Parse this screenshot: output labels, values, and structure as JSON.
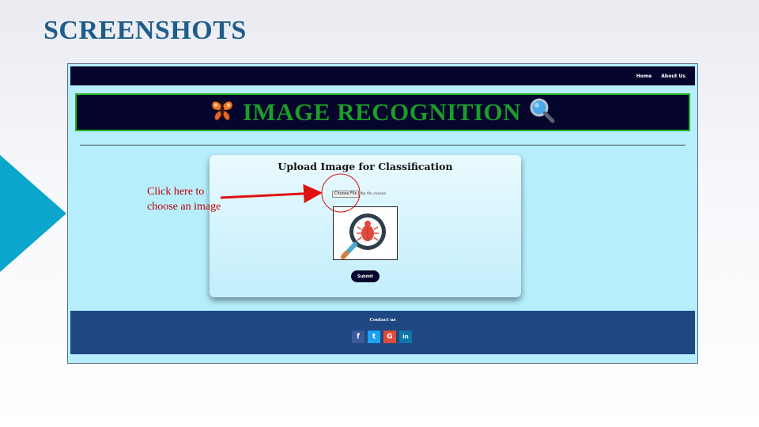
{
  "slide": {
    "title": "SCREENSHOTS"
  },
  "app": {
    "nav": {
      "items": [
        "Home",
        "About Us"
      ]
    },
    "banner": {
      "title": "IMAGE RECOGNITION",
      "left_icon": "butterfly-icon",
      "right_icon": "magnifier-icon"
    },
    "upload_card": {
      "title": "Upload Image for Classification",
      "choose_file_label": "Choose File",
      "no_file_text": "No file chosen",
      "preview_icon": "bug-magnifier-icon",
      "submit_label": "Submit"
    },
    "footer": {
      "title": "Contact us",
      "socials": [
        {
          "icon": "facebook-icon",
          "glyph": "f",
          "color": "#3b5998"
        },
        {
          "icon": "twitter-icon",
          "glyph": "t",
          "color": "#1da1f2"
        },
        {
          "icon": "google-icon",
          "glyph": "G",
          "color": "#dd4b39"
        },
        {
          "icon": "linkedin-icon",
          "glyph": "in",
          "color": "#0e76a8"
        }
      ]
    }
  },
  "annotation": {
    "line1": "Click here to",
    "line2": "choose an image",
    "color": "#c00000"
  },
  "colors": {
    "navbar": "#05052e",
    "banner_text": "#1c9c28",
    "banner_border": "#24b524",
    "page_bg": "#b6eefc",
    "footer": "#1f4782",
    "slide_title": "#1f5c8b",
    "accent_triangle": "#0aa6cc"
  }
}
